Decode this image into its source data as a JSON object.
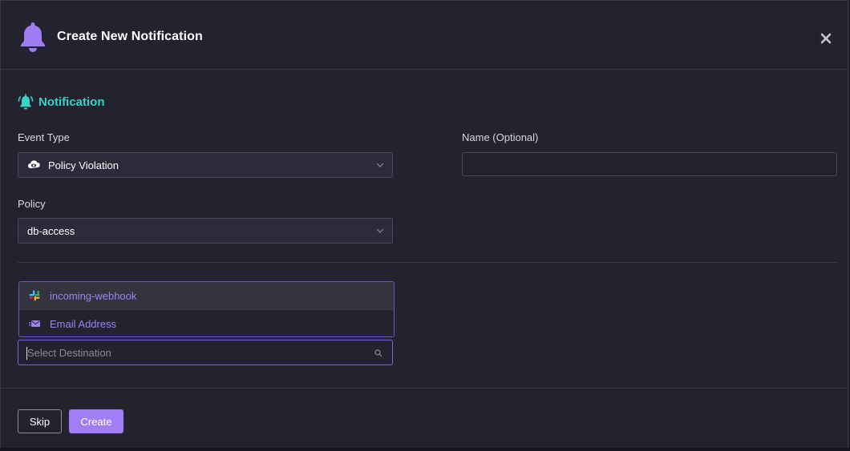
{
  "modal": {
    "title": "Create New Notification",
    "close_icon": "close-icon",
    "header_icon": "bell-icon"
  },
  "section": {
    "title": "Notification",
    "icon": "alarm-bell-icon",
    "accent_color": "#36d7c9"
  },
  "event_type": {
    "label": "Event Type",
    "value": "Policy Violation",
    "icon": "eye-cloud-icon"
  },
  "name": {
    "label": "Name (Optional)",
    "value": "",
    "placeholder": ""
  },
  "policy": {
    "label": "Policy",
    "value": "db-access"
  },
  "destination": {
    "placeholder": "Select Destination",
    "options": [
      {
        "label": "incoming-webhook",
        "icon": "slack-icon"
      },
      {
        "label": "Email Address",
        "icon": "email-icon"
      }
    ]
  },
  "buttons": {
    "skip": "Skip",
    "create": "Create"
  },
  "colors": {
    "background": "#23222f",
    "primary": "#a07ef5",
    "accent": "#36d7c9",
    "option_text": "#9d84f2"
  }
}
